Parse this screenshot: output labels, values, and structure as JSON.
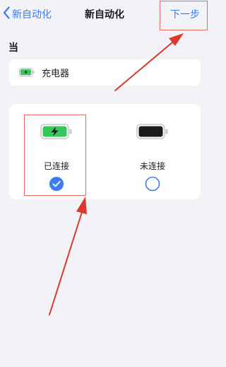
{
  "nav": {
    "back_label": "新自动化",
    "title": "新自动化",
    "next_label": "下一步"
  },
  "section": {
    "label": "当"
  },
  "trigger": {
    "icon": "battery-charging-icon",
    "label": "充电器"
  },
  "options": [
    {
      "label": "已连接",
      "icon": "battery-charging-icon",
      "selected": true
    },
    {
      "label": "未连接",
      "icon": "battery-full-icon",
      "selected": false
    }
  ],
  "colors": {
    "accent": "#3a7df5",
    "background": "#f2f2f7",
    "card": "#ffffff",
    "battery_green": "#34c759",
    "annotation_red": "#e0372b"
  }
}
